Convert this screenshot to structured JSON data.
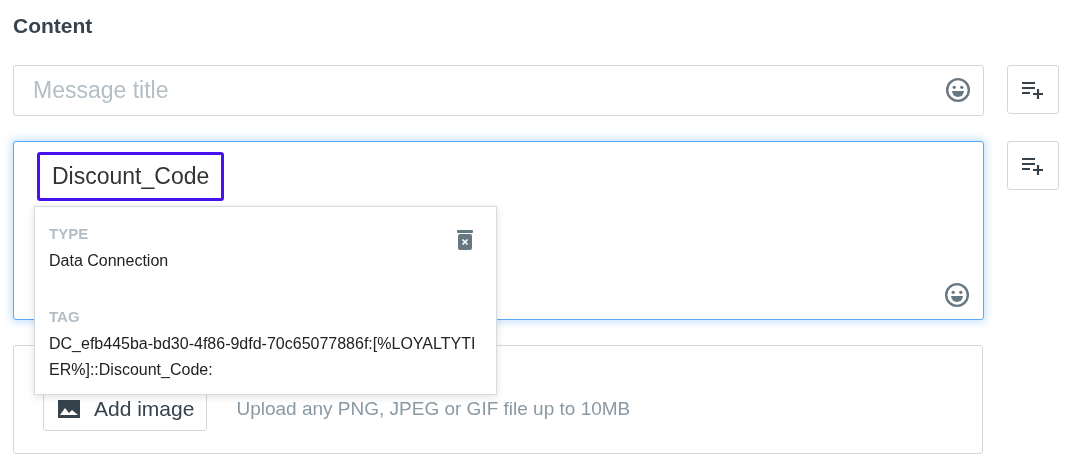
{
  "heading": "Content",
  "title_field": {
    "placeholder": "Message title"
  },
  "body_field": {
    "focused": true,
    "token": "Discount_Code"
  },
  "popover": {
    "fields": [
      {
        "label": "TYPE",
        "value": "Data Connection"
      },
      {
        "label": "TAG",
        "value": "DC_efb445ba-bd30-4f86-9dfd-70c65077886f:[%LOYALTYTIER%]::Discount_Code:"
      }
    ]
  },
  "image_upload": {
    "button": "Add image",
    "hint": "Upload any PNG, JPEG or GIF file up to 10MB"
  }
}
